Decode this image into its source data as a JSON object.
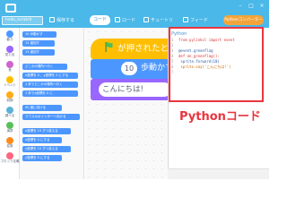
{
  "app": {
    "project_name": "hello_scratch",
    "toolbar": [
      {
        "label": "保存する"
      },
      {
        "label": "コード"
      },
      {
        "label": "ロード"
      },
      {
        "label": "チュートリ"
      },
      {
        "label": "フィード"
      }
    ],
    "active_tab": "コード",
    "python_button": "Pythonコンバーター",
    "brand_color": "#4ab8e8"
  },
  "categories": [
    {
      "label": "動き",
      "color": "#4c97ff"
    },
    {
      "label": "見た目",
      "color": "#9966ff"
    },
    {
      "label": "音",
      "color": "#cf63cf"
    },
    {
      "label": "イベント",
      "color": "#ffbf00"
    },
    {
      "label": "制御",
      "color": "#ffab19"
    },
    {
      "label": "調べる",
      "color": "#5cb1d6"
    },
    {
      "label": "演算",
      "color": "#59c059"
    },
    {
      "label": "変数",
      "color": "#ff8c1a"
    },
    {
      "label": "ブロック定義",
      "color": "#ff6680"
    }
  ],
  "palette": {
    "blocks": [
      {
        "label": "10 歩動かす"
      },
      {
        "label": "15 度回す"
      },
      {
        "label": "15 度回す"
      },
      {
        "label": "どこかの場所へ行く"
      },
      {
        "label": "x座標を 0 、y座標を 0 にする"
      },
      {
        "label": "1 秒でどこかの場所へ行く"
      },
      {
        "label": "1 秒でx座標を 0 に"
      },
      {
        "label": "90 度に向ける"
      },
      {
        "label": "マウスのポインターへ向ける"
      },
      {
        "label": "x座標を 10 ずつ変える"
      },
      {
        "label": "x座標を 0 にする"
      },
      {
        "label": "y座標を 10 ずつ変える"
      },
      {
        "label": "y座標を 0 にする"
      }
    ]
  },
  "script": {
    "hat_label": "が押されたとき",
    "move_value": "10",
    "move_label": "歩動かす",
    "say_text": "こんにちは!"
  },
  "python": {
    "header": "Python",
    "lines": [
      {
        "n": "1",
        "text": "from pylinkcl import event"
      },
      {
        "n": "2",
        "text": ""
      },
      {
        "n": "3",
        "text": "@event.greenflag"
      },
      {
        "n": "4",
        "text": "def on_greenflag():"
      },
      {
        "n": "5",
        "text": "    sprite.forward(10)"
      },
      {
        "n": "6",
        "text": "    sprite.say('こんにちは!')"
      },
      {
        "n": "7",
        "text": ""
      }
    ],
    "caption": "Pythonコード",
    "highlight_color": "#e8353f"
  }
}
